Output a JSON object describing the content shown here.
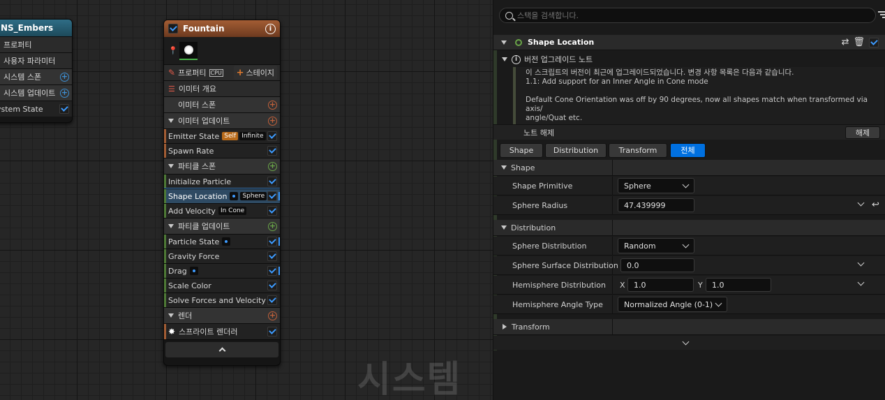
{
  "canvas": {
    "watermark": "시스템"
  },
  "system_node": {
    "title": "NS_Embers",
    "rows": [
      {
        "label": "프로퍼티"
      },
      {
        "label": "사용자 파라미터"
      },
      {
        "label": "시스템 스폰"
      },
      {
        "label": "시스템 업데이트"
      },
      {
        "label": "ystem State"
      }
    ]
  },
  "emitter_node": {
    "title": "Fountain",
    "properties_label": "프로퍼티",
    "cpu_label": "CPU",
    "stage_label": "스테이지",
    "summary_label": "이미터 개요",
    "emitter_spawn": "이미터 스폰",
    "emitter_update": "이미터 업데이트",
    "emitter_state": "Emitter State",
    "tag_self": "Self",
    "tag_infinite": "Infinite",
    "spawn_rate": "Spawn Rate",
    "particle_spawn": "파티클 스폰",
    "initialize_particle": "Initialize Particle",
    "shape_location": "Shape Location",
    "tag_sphere": "Sphere",
    "add_velocity": "Add Velocity",
    "tag_in_cone": "In Cone",
    "particle_update": "파티클 업데이트",
    "particle_state": "Particle State",
    "gravity_force": "Gravity Force",
    "drag": "Drag",
    "scale_color": "Scale Color",
    "solve_forces": "Solve Forces and Velocity",
    "render": "렌더",
    "sprite_renderer": "스프라이트 렌더러"
  },
  "panel": {
    "search_placeholder": "스택을 검색합니다.",
    "module_title": "Shape Location",
    "note_title": "버전 업그레이드 노트",
    "note_line1": "이 스크립트의 버전이 최근에 업그레이드되었습니다. 변경 사항 목록은 다음과 같습니다.",
    "note_line2": "1.1: Add support for an Inner Angle in Cone mode",
    "note_line3": "Default Cone Orientation was off by 90 degrees, now all shapes match when transformed via axis/",
    "note_line4": "angle/Quat etc.",
    "dismiss_label": "노트 해제",
    "dismiss_button": "해제",
    "tabs": [
      "Shape",
      "Distribution",
      "Transform",
      "전체"
    ],
    "active_tab": "전체",
    "shape_section": "Shape",
    "shape_primitive_label": "Shape Primitive",
    "shape_primitive_value": "Sphere",
    "sphere_radius_label": "Sphere Radius",
    "sphere_radius_value": "47.439999",
    "distribution_section": "Distribution",
    "sphere_distribution_label": "Sphere Distribution",
    "sphere_distribution_value": "Random",
    "surface_distribution_label": "Sphere Surface Distribution",
    "surface_distribution_value": "0.0",
    "hemisphere_distribution_label": "Hemisphere Distribution",
    "hemi_x_label": "X",
    "hemi_x_value": "1.0",
    "hemi_y_label": "Y",
    "hemi_y_value": "1.0",
    "hemisphere_angle_label": "Hemisphere Angle Type",
    "hemisphere_angle_value": "Normalized Angle (0-1)",
    "transform_section": "Transform"
  },
  "colors": {
    "accent": "#0070e0",
    "check": "#3d9bff",
    "emitter_header": "#a35d34",
    "system_header": "#2f6d86"
  }
}
